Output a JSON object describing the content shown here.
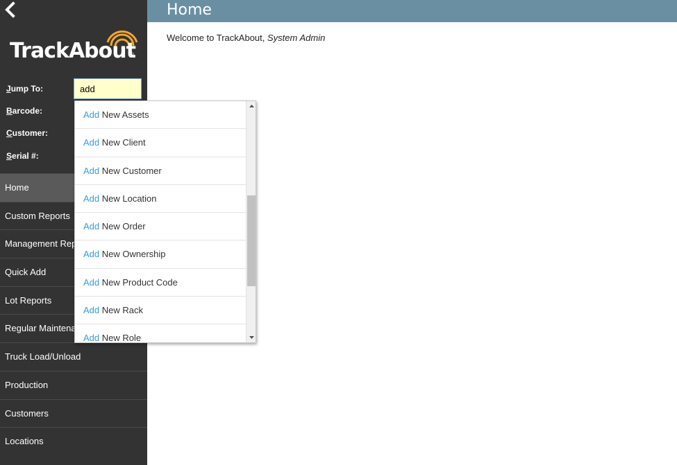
{
  "brand": {
    "name": "TrackAbout",
    "registered": "®",
    "wave_color": "#f5a623"
  },
  "header": {
    "title": "Home",
    "color": "#6a8fa3"
  },
  "welcome": {
    "prefix": "Welcome to TrackAbout, ",
    "user": "System Admin"
  },
  "quick_fields": {
    "jump_to": {
      "label_first": "J",
      "label_rest": "ump To:",
      "value": "add"
    },
    "barcode": {
      "label_first": "B",
      "label_rest": "arcode:"
    },
    "customer": {
      "label_first": "C",
      "label_rest": "ustomer:"
    },
    "serial": {
      "label_first": "S",
      "label_rest": "erial #:"
    }
  },
  "nav": {
    "items": [
      {
        "label": "Home"
      },
      {
        "label": "Custom Reports"
      },
      {
        "label": "Management Reports"
      },
      {
        "label": "Quick Add"
      },
      {
        "label": "Lot Reports"
      },
      {
        "label": "Regular Maintenance"
      },
      {
        "label": "Truck Load/Unload"
      },
      {
        "label": "Production"
      },
      {
        "label": "Customers"
      },
      {
        "label": "Locations"
      }
    ]
  },
  "autocomplete": {
    "items": [
      {
        "match": "Add",
        "rest": " New Assets"
      },
      {
        "match": "Add",
        "rest": " New Client"
      },
      {
        "match": "Add",
        "rest": " New Customer"
      },
      {
        "match": "Add",
        "rest": " New Location"
      },
      {
        "match": "Add",
        "rest": " New Order"
      },
      {
        "match": "Add",
        "rest": " New Ownership"
      },
      {
        "match": "Add",
        "rest": " New Product Code"
      },
      {
        "match": "Add",
        "rest": " New Rack"
      },
      {
        "match": "Add",
        "rest": " New Role"
      }
    ]
  }
}
